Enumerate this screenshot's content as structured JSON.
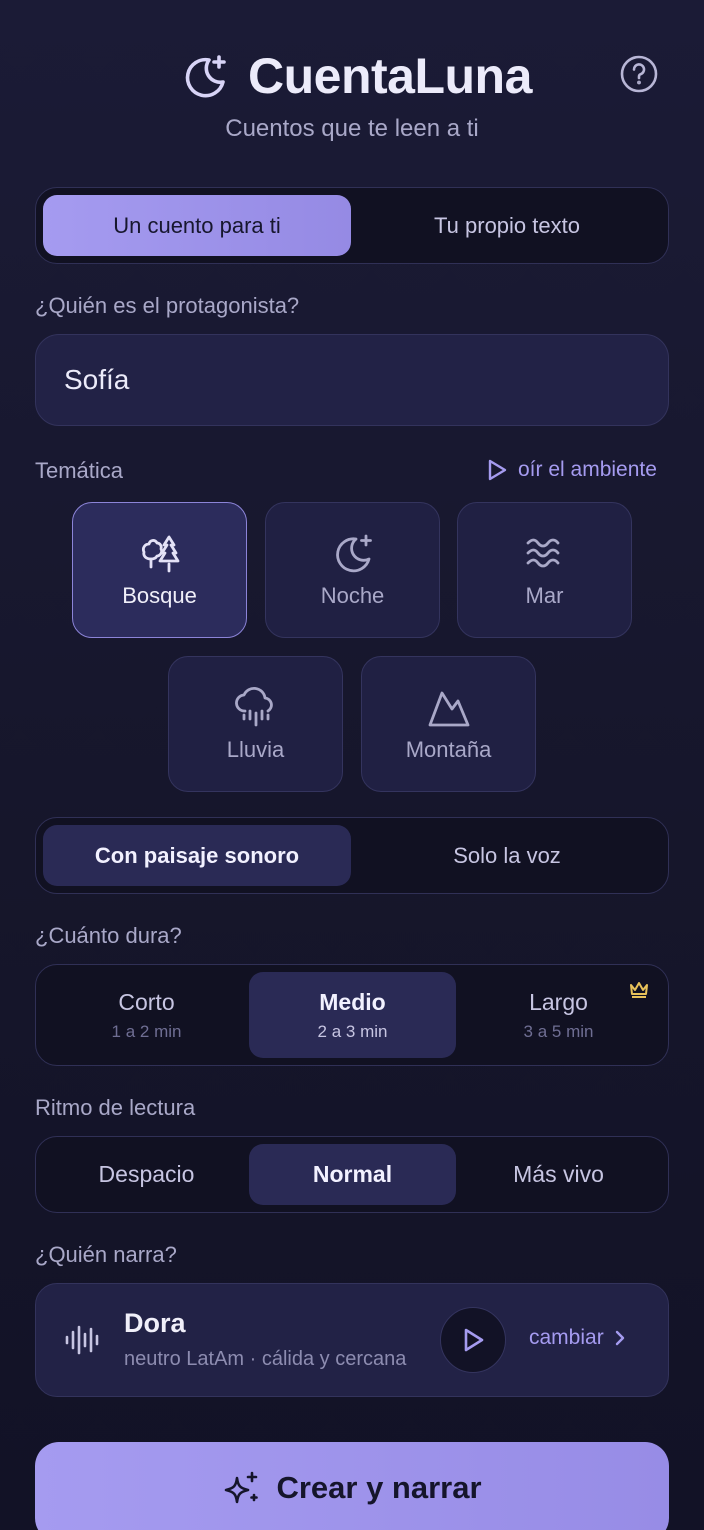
{
  "header": {
    "title": "CuentaLuna",
    "subtitle": "Cuentos que te leen a ti",
    "logo_icon": "moon-sparkle-icon",
    "help_icon": "help-circle-icon"
  },
  "mode_tabs": [
    {
      "label": "Un cuento para ti",
      "active": true
    },
    {
      "label": "Tu propio texto",
      "active": false
    }
  ],
  "protagonist": {
    "label": "¿Quién es el protagonista?",
    "value": "Sofía"
  },
  "theme": {
    "label": "Temática",
    "ambient_link": "oír el ambiente",
    "options": [
      {
        "label": "Bosque",
        "icon": "trees-icon",
        "selected": true
      },
      {
        "label": "Noche",
        "icon": "moon-icon",
        "selected": false
      },
      {
        "label": "Mar",
        "icon": "waves-icon",
        "selected": false
      },
      {
        "label": "Lluvia",
        "icon": "rain-cloud-icon",
        "selected": false
      },
      {
        "label": "Montaña",
        "icon": "mountain-icon",
        "selected": false
      }
    ]
  },
  "sound_tabs": [
    {
      "label": "Con paisaje sonoro",
      "active": true
    },
    {
      "label": "Solo la voz",
      "active": false
    }
  ],
  "duration": {
    "label": "¿Cuánto dura?",
    "options": [
      {
        "name": "Corto",
        "sub": "1 a 2 min",
        "active": false
      },
      {
        "name": "Medio",
        "sub": "2 a 3 min",
        "active": true
      },
      {
        "name": "Largo",
        "sub": "3 a 5 min",
        "active": false,
        "premium_icon": "crown-icon"
      }
    ]
  },
  "rhythm": {
    "label": "Ritmo de lectura",
    "options": [
      {
        "label": "Despacio",
        "active": false
      },
      {
        "label": "Normal",
        "active": true
      },
      {
        "label": "Más vivo",
        "active": false
      }
    ]
  },
  "narrator": {
    "label": "¿Quién narra?",
    "name": "Dora",
    "description": "neutro LatAm · cálida y cercana",
    "change_label": "cambiar"
  },
  "cta": {
    "label": "Crear y narrar"
  },
  "colors": {
    "accent": "#a59bf0",
    "background": "#16162b",
    "card": "#222246",
    "premium": "#e8c25a"
  }
}
